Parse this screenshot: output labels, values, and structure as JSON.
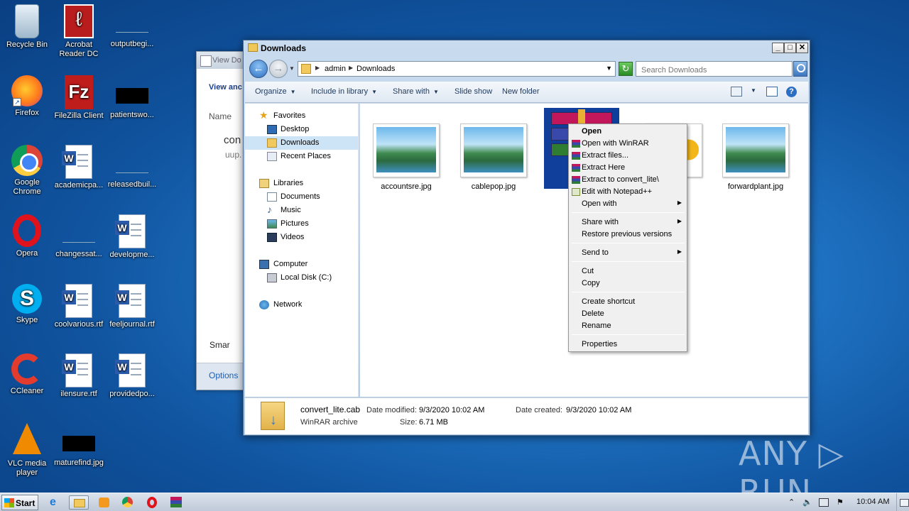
{
  "desktop": {
    "icons": [
      {
        "label": "Recycle Bin"
      },
      {
        "label": "Acrobat\nReader DC"
      },
      {
        "label": "outputbegi..."
      },
      {
        "label": "Firefox"
      },
      {
        "label": "FileZilla Client"
      },
      {
        "label": "patientswo..."
      },
      {
        "label": "Google\nChrome"
      },
      {
        "label": "academicpa..."
      },
      {
        "label": "releasedbuil..."
      },
      {
        "label": "Opera"
      },
      {
        "label": "changessat..."
      },
      {
        "label": "developme..."
      },
      {
        "label": "Skype"
      },
      {
        "label": "coolvarious.rtf"
      },
      {
        "label": "feeljournal.rtf"
      },
      {
        "label": "CCleaner"
      },
      {
        "label": "ilensure.rtf"
      },
      {
        "label": "providedpo..."
      },
      {
        "label": "VLC media\nplayer"
      },
      {
        "label": "maturefind.jpg"
      }
    ]
  },
  "bg_window": {
    "title": "View Do",
    "link": "View anc",
    "col_name": "Name",
    "item": "con",
    "item_sub": "uup.",
    "smart": "Smar",
    "options": "Options"
  },
  "explorer": {
    "title": "Downloads",
    "min_label": "_",
    "max_label": "□",
    "close_label": "✕",
    "back_glyph": "←",
    "forward_glyph": "→",
    "breadcrumb": [
      "admin",
      "Downloads"
    ],
    "search_placeholder": "Search Downloads",
    "toolbar": {
      "organize": "Organize",
      "include": "Include in library",
      "share": "Share with",
      "slideshow": "Slide show",
      "newfolder": "New folder"
    },
    "nav": {
      "favorites": "Favorites",
      "desktop": "Desktop",
      "downloads": "Downloads",
      "recent": "Recent Places",
      "libraries": "Libraries",
      "documents": "Documents",
      "music": "Music",
      "pictures": "Pictures",
      "videos": "Videos",
      "computer": "Computer",
      "localdisk": "Local Disk (C:)",
      "network": "Network"
    },
    "files": [
      {
        "name": "accountsre.jpg"
      },
      {
        "name": "cablepop.jpg"
      },
      {
        "name": "conv"
      },
      {
        "name": "forwardplant.jpg"
      }
    ],
    "details": {
      "filename": "convert_lite.cab",
      "type": "WinRAR archive",
      "modified_label": "Date modified:",
      "modified": "9/3/2020 10:02 AM",
      "created_label": "Date created:",
      "created": "9/3/2020 10:02 AM",
      "size_label": "Size:",
      "size": "6.71 MB"
    }
  },
  "context_menu": {
    "open": "Open",
    "open_winrar": "Open with WinRAR",
    "extract_files": "Extract files...",
    "extract_here": "Extract Here",
    "extract_to": "Extract to convert_lite\\",
    "edit_npp": "Edit with Notepad++",
    "open_with": "Open with",
    "share_with": "Share with",
    "restore": "Restore previous versions",
    "send_to": "Send to",
    "cut": "Cut",
    "copy": "Copy",
    "create_shortcut": "Create shortcut",
    "delete": "Delete",
    "rename": "Rename",
    "properties": "Properties"
  },
  "taskbar": {
    "start": "Start",
    "clock": "10:04 AM",
    "tray_arrow": "⌃"
  },
  "watermark": "ANY ▷ RUN",
  "colors": {
    "selection": "#0f3f9a",
    "desktop": "#1f74c4",
    "menu_bg": "#f0f0f0"
  }
}
